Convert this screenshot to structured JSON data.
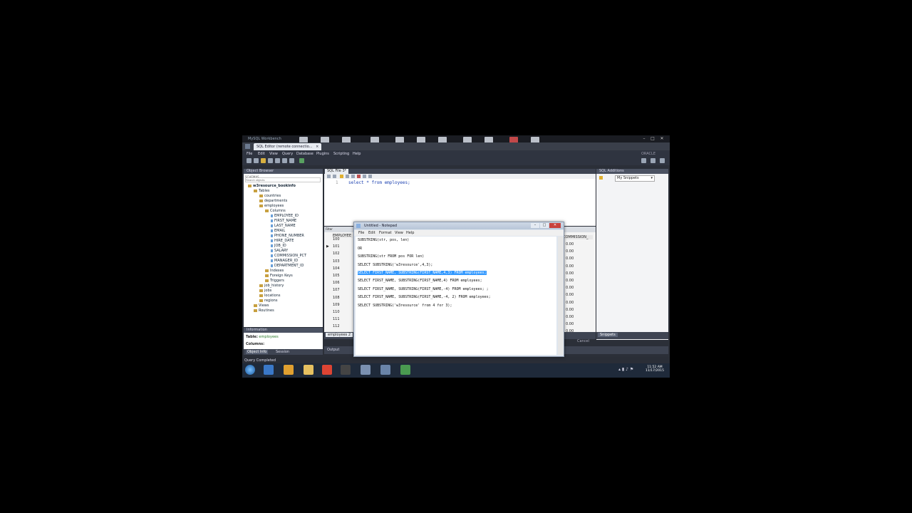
{
  "window": {
    "app_title": "MySQL Workbench",
    "controls": [
      "–",
      "□",
      "✕"
    ]
  },
  "tabs": {
    "active": "SQL Editor (remote connectio...",
    "close": "×"
  },
  "menu": [
    "File",
    "Edit",
    "View",
    "Query",
    "Database",
    "Plugins",
    "Scripting",
    "Help"
  ],
  "brand": "ORACLE",
  "object_browser": {
    "title": "Object Browser",
    "schemas_label": "SCHEMAS",
    "search_placeholder": "Search objects",
    "db": "w3resource_bookinfo",
    "tree": [
      {
        "label": "Tables",
        "level": 1
      },
      {
        "label": "countries",
        "level": 2
      },
      {
        "label": "departments",
        "level": 2
      },
      {
        "label": "employees",
        "level": 2
      },
      {
        "label": "Columns",
        "level": 3
      },
      {
        "label": "EMPLOYEE_ID",
        "level": 4
      },
      {
        "label": "FIRST_NAME",
        "level": 4
      },
      {
        "label": "LAST_NAME",
        "level": 4
      },
      {
        "label": "EMAIL",
        "level": 4
      },
      {
        "label": "PHONE_NUMBER",
        "level": 4
      },
      {
        "label": "HIRE_DATE",
        "level": 4
      },
      {
        "label": "JOB_ID",
        "level": 4
      },
      {
        "label": "SALARY",
        "level": 4
      },
      {
        "label": "COMMISSION_PCT",
        "level": 4
      },
      {
        "label": "MANAGER_ID",
        "level": 4
      },
      {
        "label": "DEPARTMENT_ID",
        "level": 4
      },
      {
        "label": "Indexes",
        "level": 3
      },
      {
        "label": "Foreign Keys",
        "level": 3
      },
      {
        "label": "Triggers",
        "level": 3
      },
      {
        "label": "job_history",
        "level": 2
      },
      {
        "label": "jobs",
        "level": 2
      },
      {
        "label": "locations",
        "level": 2
      },
      {
        "label": "regions",
        "level": 2
      },
      {
        "label": "Views",
        "level": 1
      },
      {
        "label": "Routines",
        "level": 1
      }
    ]
  },
  "information": {
    "title": "Information",
    "table_label": "Table:",
    "table_value": "employees",
    "columns_label": "Columns:",
    "tabs": [
      "Object Info",
      "Session"
    ]
  },
  "sql_editor": {
    "tab": "SQL File 3*",
    "line_no": "1",
    "query": "select * from employees;"
  },
  "results": {
    "header": "EMPLOYEE",
    "rows": [
      "100",
      "101",
      "102",
      "103",
      "104",
      "105",
      "106",
      "107",
      "108",
      "109",
      "110",
      "111",
      "112"
    ],
    "filter_label": "Filter",
    "result_tab": "employees 2",
    "right_header": "COMMISSION_",
    "right_values": [
      "0.00",
      "0.00",
      "0.00",
      "0.00",
      "0.00",
      "0.00",
      "0.00",
      "0.00",
      "0.00",
      "0.00",
      "0.00",
      "0.00",
      "0.00"
    ],
    "cancel": "Cancel"
  },
  "sql_additions": {
    "title": "SQL Additions",
    "dropdown": "My Snippets",
    "bottom_tab": "Snippets"
  },
  "output": {
    "label": "Output"
  },
  "status": "Query Completed",
  "notepad": {
    "title": "Untitled - Notepad",
    "menu": [
      "File",
      "Edit",
      "Format",
      "View",
      "Help"
    ],
    "lines": [
      {
        "text": "SUBSTRING(str, pos, len)",
        "selected": false
      },
      {
        "text": "OR",
        "selected": false
      },
      {
        "text": "SUBSTRING(str FROM pos FOR len)",
        "selected": false
      },
      {
        "text": "SELECT SUBSTRING('w3resource',4,3);",
        "selected": false
      },
      {
        "text": "SELECT FIRST_NAME, SUBSTRING(FIRST_NAME,4,3) FROM employees;",
        "selected": true
      },
      {
        "text": "SELECT FIRST_NAME, SUBSTRING(FIRST_NAME,4) FROM employees;",
        "selected": false
      },
      {
        "text": "SELECT FIRST_NAME, SUBSTRING(FIRST_NAME,-4) FROM employees; ;",
        "selected": false
      },
      {
        "text": "SELECT FIRST_NAME, SUBSTRING(FIRST_NAME,-4, 2) FROM employees;",
        "selected": false
      },
      {
        "text": "SELECT SUBSTRING('w3resource' from 4 for 3);",
        "selected": false
      }
    ]
  },
  "taskbar": {
    "time": "11:52 AM",
    "date": "11/17/2015"
  }
}
